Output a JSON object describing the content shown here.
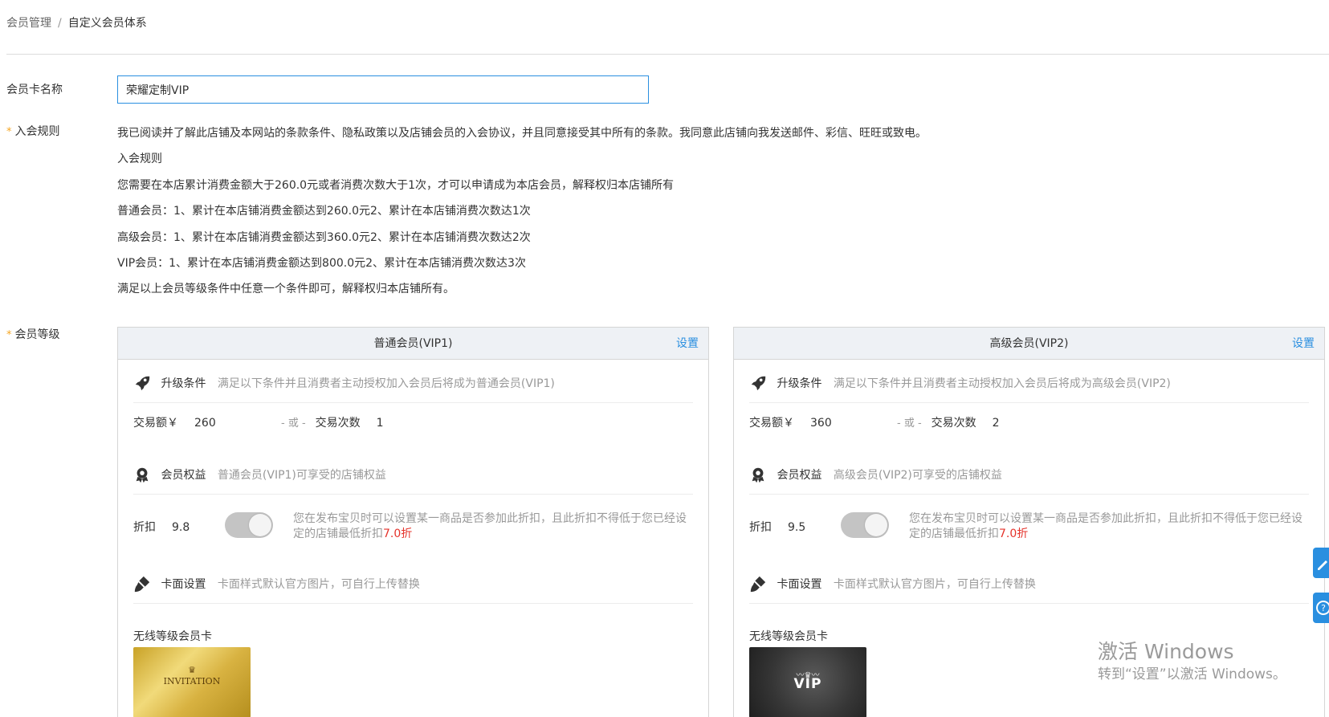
{
  "breadcrumb": {
    "parent": "会员管理",
    "separator": "/",
    "current": "自定义会员体系"
  },
  "form": {
    "card_name_label": "会员卡名称",
    "card_name_value": "荣耀定制VIP",
    "required_mark": "*",
    "rules_label": "入会规则",
    "level_label": "会员等级"
  },
  "rules": [
    "我已阅读并了解此店铺及本网站的条款条件、隐私政策以及店铺会员的入会协议，并且同意接受其中所有的条款。我同意此店铺向我发送邮件、彩信、旺旺或致电。",
    "入会规则",
    "您需要在本店累计消费金额大于260.0元或者消费次数大于1次，才可以申请成为本店会员，解释权归本店铺所有",
    "普通会员：1、累计在本店铺消费金额达到260.0元2、累计在本店铺消费次数达1次",
    "高级会员：1、累计在本店铺消费金额达到360.0元2、累计在本店铺消费次数达2次",
    "VIP会员：1、累计在本店铺消费金额达到800.0元2、累计在本店铺消费次数达3次",
    "满足以上会员等级条件中任意一个条件即可，解释权归本店铺所有。"
  ],
  "levels": [
    {
      "title": "普通会员(VIP1)",
      "set_label": "设置",
      "upgrade_title": "升级条件",
      "upgrade_desc": "满足以下条件并且消费者主动授权加入会员后将成为普通会员(VIP1)",
      "amount_label": "交易额￥",
      "amount_value": "260",
      "or_label": "- 或 -",
      "count_label": "交易次数",
      "count_value": "1",
      "benefit_title": "会员权益",
      "benefit_desc": "普通会员(VIP1)可享受的店铺权益",
      "discount_label": "折扣",
      "discount_value": "9.8",
      "discount_note": "您在发布宝贝时可以设置某一商品是否参加此折扣，且此折扣不得低于您已经设定的店铺最低折扣",
      "min_discount": "7.0折",
      "face_title": "卡面设置",
      "face_desc": "卡面样式默认官方图片，可自行上传替换",
      "card_type": "无线等级会员卡",
      "card_text": "INVITATION"
    },
    {
      "title": "高级会员(VIP2)",
      "set_label": "设置",
      "upgrade_title": "升级条件",
      "upgrade_desc": "满足以下条件并且消费者主动授权加入会员后将成为高级会员(VIP2)",
      "amount_label": "交易额￥",
      "amount_value": "360",
      "or_label": "- 或 -",
      "count_label": "交易次数",
      "count_value": "2",
      "benefit_title": "会员权益",
      "benefit_desc": "高级会员(VIP2)可享受的店铺权益",
      "discount_label": "折扣",
      "discount_value": "9.5",
      "discount_note": "您在发布宝贝时可以设置某一商品是否参加此折扣，且此折扣不得低于您已经设定的店铺最低折扣",
      "min_discount": "7.0折",
      "face_title": "卡面设置",
      "face_desc": "卡面样式默认官方图片，可自行上传替换",
      "card_type": "无线等级会员卡",
      "card_text": "VIP"
    }
  ],
  "colors": {
    "link": "#2a8fe0",
    "required": "#f5a623",
    "highlight": "#e5332b"
  },
  "watermark": {
    "line1": "激活 Windows",
    "line2": "转到“设置”以激活 Windows。"
  }
}
